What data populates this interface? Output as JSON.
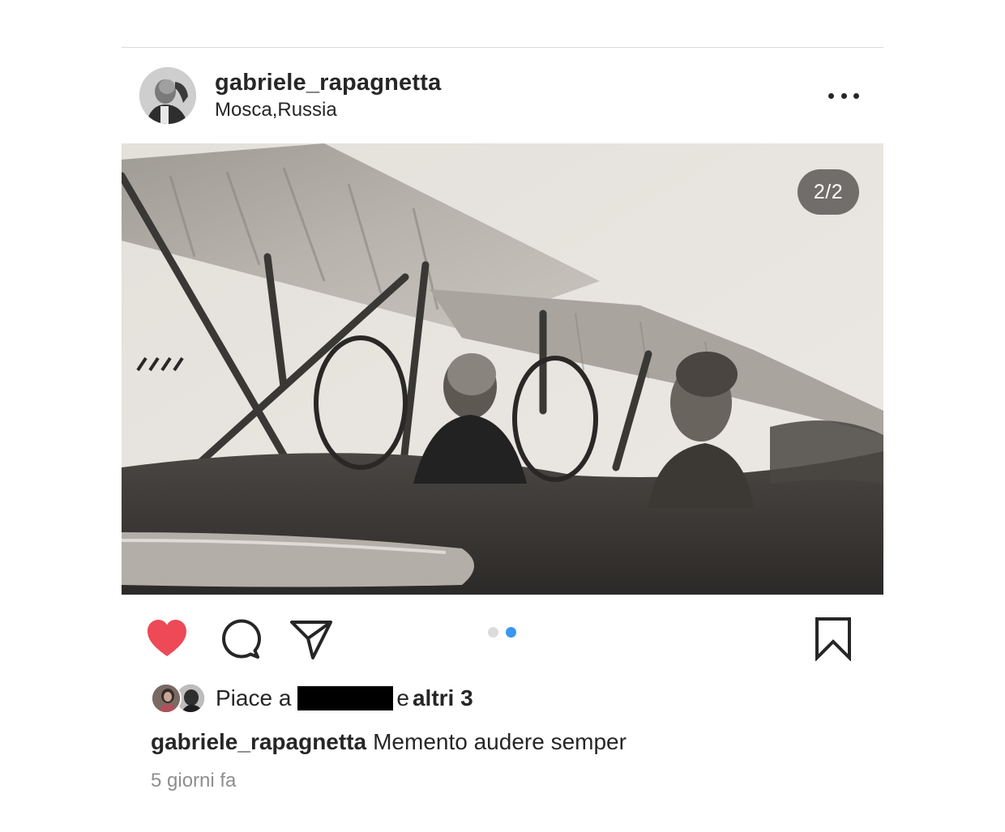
{
  "post": {
    "username": "gabriele_rapagnetta",
    "location": "Mosca,Russia",
    "image_counter": "2/2",
    "carousel": {
      "count": 2,
      "active_index": 2
    },
    "likes": {
      "prefix": "Piace a",
      "conjunction": "e",
      "others": "altri 3"
    },
    "caption": {
      "username": "gabriele_rapagnetta",
      "text": "Memento audere semper"
    },
    "timestamp": "5 giorni fa"
  },
  "icons": {
    "more": "more-options-icon",
    "like": "heart-icon",
    "comment": "comment-icon",
    "share": "paper-plane-icon",
    "save": "bookmark-icon"
  },
  "colors": {
    "like_active": "#ed4956",
    "carousel_active": "#3897f0",
    "carousel_inactive": "#dbdbdb",
    "secondary_text": "#8e8e8e"
  }
}
